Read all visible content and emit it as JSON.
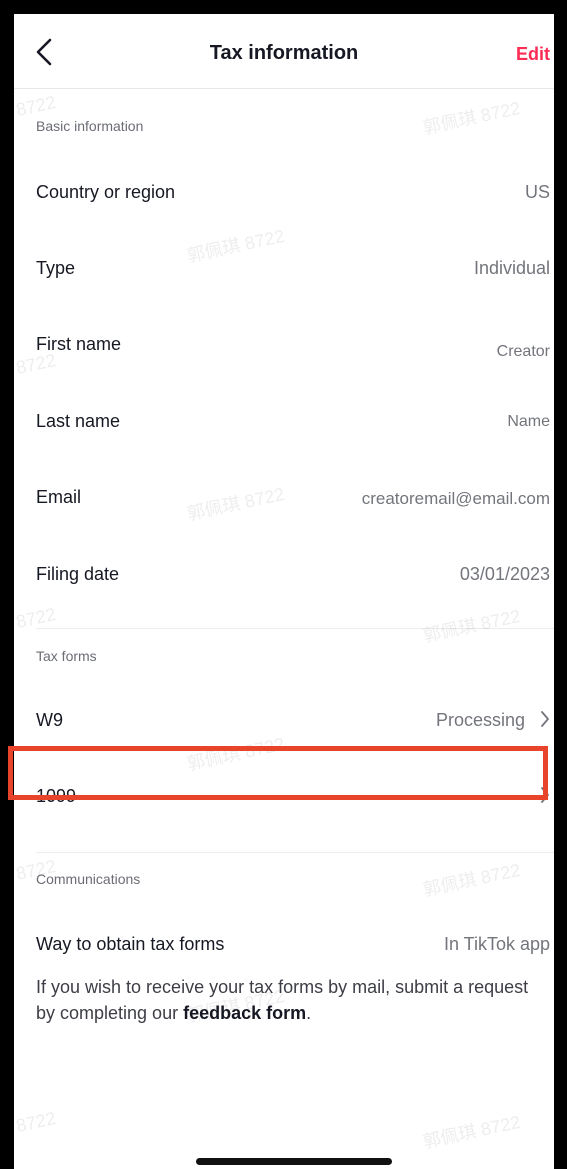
{
  "header": {
    "title": "Tax information",
    "edit_label": "Edit"
  },
  "basic": {
    "section_title": "Basic information",
    "rows": [
      {
        "label": "Country or region",
        "value": "US"
      },
      {
        "label": "Type",
        "value": "Individual"
      },
      {
        "label": "First name",
        "value": "Creator"
      },
      {
        "label": "Last name",
        "value": "Name"
      },
      {
        "label": "Email",
        "value": "creatoremail@email.com"
      },
      {
        "label": "Filing date",
        "value": "03/01/2023"
      }
    ]
  },
  "tax_forms": {
    "section_title": "Tax forms",
    "rows": [
      {
        "label": "W9",
        "value": "Processing"
      },
      {
        "label": "1099",
        "value": ""
      }
    ]
  },
  "communications": {
    "section_title": "Communications",
    "rows": [
      {
        "label": "Way to obtain tax forms",
        "value": "In TikTok app"
      }
    ],
    "note_prefix": "If you wish to receive your tax forms by mail, submit a request by completing our ",
    "note_link": "feedback form",
    "note_suffix": "."
  },
  "watermark": {
    "text_num": "8722",
    "text_full": "郭佩琪 8722"
  },
  "colors": {
    "accent": "#fe2c55",
    "highlight": "#e8442c"
  },
  "icons": {
    "back": "chevron-left-icon",
    "forward": "chevron-right-icon"
  }
}
